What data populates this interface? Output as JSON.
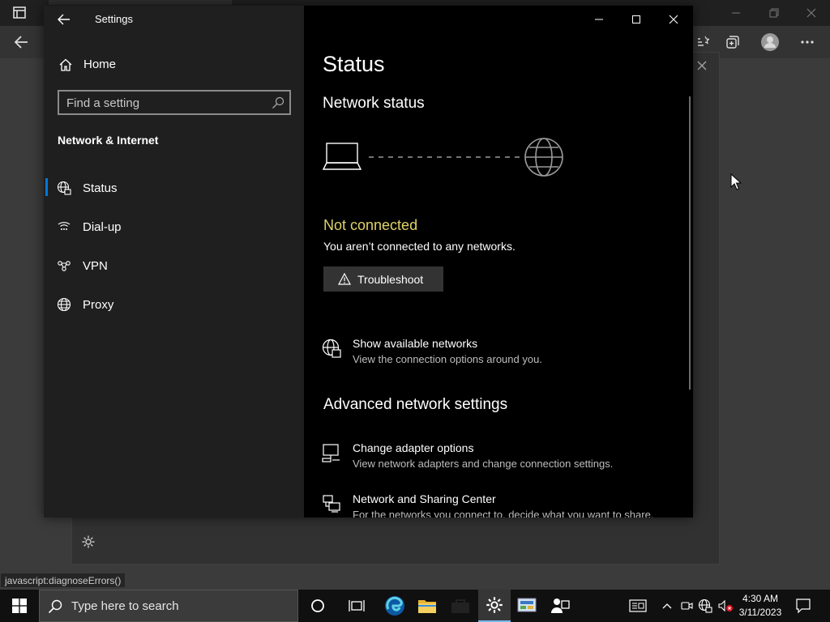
{
  "status_bar": {
    "url": "javascript:diagnoseErrors()"
  },
  "settings": {
    "app_title": "Settings",
    "nav": {
      "home_label": "Home",
      "search_placeholder": "Find a setting",
      "section_title": "Network & Internet",
      "items": [
        {
          "label": "Status",
          "icon": "status-globe-icon",
          "active": true
        },
        {
          "label": "Dial-up",
          "icon": "dialup-icon",
          "active": false
        },
        {
          "label": "VPN",
          "icon": "vpn-icon",
          "active": false
        },
        {
          "label": "Proxy",
          "icon": "globe-icon",
          "active": false
        }
      ]
    },
    "content": {
      "page_title": "Status",
      "network_status_heading": "Network status",
      "connection_state": "Not connected",
      "connection_desc": "You aren’t connected to any networks.",
      "troubleshoot_label": "Troubleshoot",
      "show_networks": {
        "title": "Show available networks",
        "desc": "View the connection options around you."
      },
      "advanced_heading": "Advanced network settings",
      "change_adapter": {
        "title": "Change adapter options",
        "desc": "View network adapters and change connection settings."
      },
      "sharing_center": {
        "title": "Network and Sharing Center",
        "desc": "For the networks you connect to, decide what you want to share."
      }
    }
  },
  "taskbar": {
    "search_placeholder": "Type here to search",
    "time": "4:30 AM",
    "date": "3/11/2023"
  },
  "colors": {
    "accent": "#0078d7",
    "warning_text": "#dfd266",
    "taskbar": "#101010"
  }
}
